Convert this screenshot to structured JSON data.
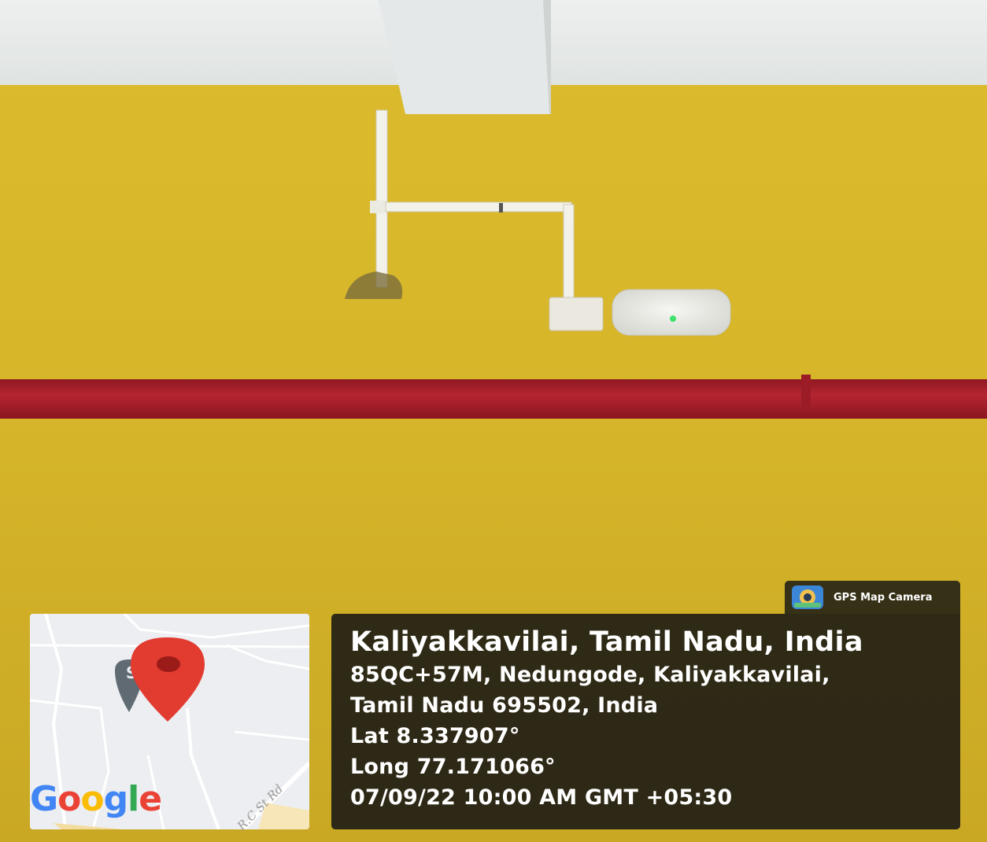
{
  "badge": {
    "app_name": "GPS Map Camera",
    "icon": "camera-globe-icon"
  },
  "location": {
    "title": "Kaliyakkavilai, Tamil Nadu, India",
    "address_line_1": "85QC+57M, Nedungode, Kaliyakkavilai,",
    "address_line_2": "Tamil Nadu 695502, India",
    "latitude": "Lat 8.337907°",
    "longitude": "Long 77.171066°",
    "timestamp": "07/09/22 10:00 AM GMT +05:30"
  },
  "map": {
    "brand": {
      "G": "G",
      "o1": "o",
      "o2": "o",
      "g": "g",
      "l": "l",
      "e": "e"
    },
    "street": "R.C St Rd",
    "pin_icon": "location-pin-icon"
  },
  "colors": {
    "wall_yellow": "#d9b92a",
    "red_pipe": "#a8202a",
    "pin_red": "#e23b30",
    "overlay": "#141414"
  }
}
